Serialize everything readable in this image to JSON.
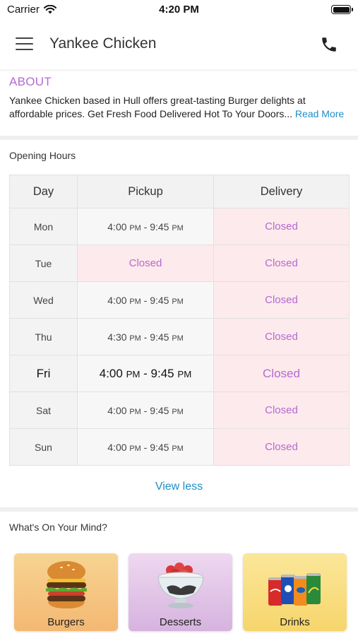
{
  "status_bar": {
    "carrier": "Carrier",
    "time": "4:20 PM"
  },
  "header": {
    "title": "Yankee Chicken"
  },
  "about": {
    "title": "ABOUT",
    "text": "Yankee Chicken based in Hull offers great-tasting Burger delights at affordable prices. Get Fresh Food Delivered Hot To Your Doors...",
    "read_more": "Read More"
  },
  "opening_hours": {
    "label": "Opening Hours",
    "columns": [
      "Day",
      "Pickup",
      "Delivery"
    ],
    "rows": [
      {
        "day": "Mon",
        "pickup": "4:00 PM - 9:45 PM",
        "delivery": "Closed"
      },
      {
        "day": "Tue",
        "pickup": "Closed",
        "delivery": "Closed"
      },
      {
        "day": "Wed",
        "pickup": "4:00 PM - 9:45 PM",
        "delivery": "Closed"
      },
      {
        "day": "Thu",
        "pickup": "4:30 PM - 9:45 PM",
        "delivery": "Closed"
      },
      {
        "day": "Fri",
        "pickup": "4:00 PM - 9:45 PM",
        "delivery": "Closed",
        "today": true
      },
      {
        "day": "Sat",
        "pickup": "4:00 PM - 9:45 PM",
        "delivery": "Closed"
      },
      {
        "day": "Sun",
        "pickup": "4:00 PM - 9:45 PM",
        "delivery": "Closed"
      }
    ],
    "view_less": "View less"
  },
  "categories": {
    "label": "What's On Your Mind?",
    "items": [
      {
        "label": "Burgers",
        "icon": "burger-icon"
      },
      {
        "label": "Desserts",
        "icon": "dessert-bowl-icon"
      },
      {
        "label": "Drinks",
        "icon": "soda-cans-icon"
      }
    ]
  },
  "colors": {
    "accent_purple": "#b46ad3",
    "link_blue": "#1d8fc7",
    "closed_bg": "#fdeaec"
  }
}
